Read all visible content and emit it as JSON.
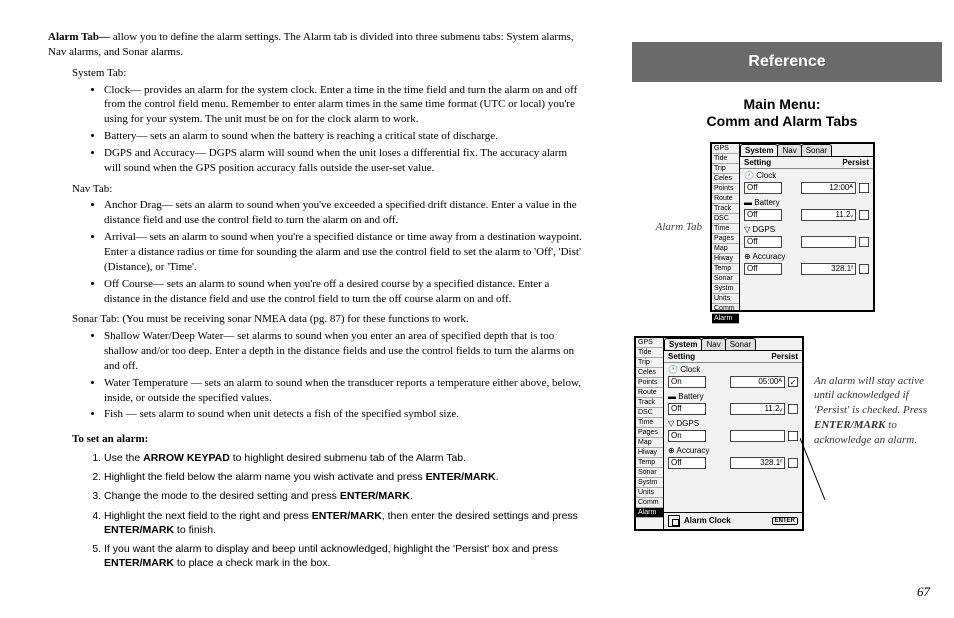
{
  "leftColumn": {
    "intro_bold": "Alarm Tab— ",
    "intro_rest": "allow you to define the alarm settings. The Alarm tab is divided into three submenu tabs: System alarms, Nav alarms, and Sonar alarms.",
    "systemTab_head": "System Tab:",
    "systemTab_items": {
      "0": "Clock— provides an alarm for the system clock. Enter a time in the time field and turn the alarm on and off from the control field menu. Remember to enter alarm times in the same time format (UTC or local) you're using for your system. The unit must be on for the clock alarm to work.",
      "1": "Battery— sets an alarm to sound when the battery is reaching a critical state of discharge.",
      "2": "DGPS and Accuracy— DGPS alarm will sound when the unit loses a differential fix. The accuracy alarm will sound when the GPS position accuracy falls outside the user-set value."
    },
    "navTab_head": "Nav Tab:",
    "navTab_items": {
      "0": "Anchor Drag— sets an alarm to sound when you've exceeded a specified drift distance. Enter a value in the distance field and use the control field to turn the alarm on and off.",
      "1": "Arrival— sets an alarm to sound when you're a specified distance or time away from a destination waypoint. Enter a distance radius or time for sounding the alarm and use the control field to set the alarm to 'Off', 'Dist' (Distance), or 'Time'.",
      "2": "Off Course— sets an alarm to sound when you're off a desired course by a specified distance. Enter a distance in the distance field and use the control field to turn the off course alarm on and off."
    },
    "sonarTab_head": "Sonar Tab: (You must be receiving sonar NMEA data (pg. 87) for these functions to work.",
    "sonarTab_items": {
      "0": "Shallow Water/Deep Water— set alarms to sound when you enter an area of specified depth that is too shallow and/or too deep. Enter a depth in the distance fields and use the control fields to turn the alarms on and off.",
      "1": "Water Temperature — sets an alarm to sound when the transducer reports a temperature either above, below, inside, or outside the specified values.",
      "2": "Fish — sets alarm to sound when unit detects a fish of the specified symbol size."
    },
    "setalarm_head": "To set an alarm:",
    "steps": {
      "0_a": "Use the ",
      "0_b": "ARROW KEYPAD",
      "0_c": " to highlight desired submenu tab of the Alarm Tab.",
      "1_a": "Highlight the field below the alarm name you wish activate and press ",
      "1_b": "ENTER/MARK",
      "1_c": ".",
      "2_a": "Change the mode to the desired setting and press ",
      "2_b": "ENTER/MARK",
      "2_c": ".",
      "3_a": "Highlight the next field to the right and press ",
      "3_b": "ENTER/MARK",
      "3_c": ", then enter the desired settings and press ",
      "3_d": "ENTER/MARK",
      "3_e": " to finish.",
      "4_a": "If you want the alarm to display and beep until acknowledged, highlight the 'Persist' box and press ",
      "4_b": "ENTER/MARK",
      "4_c": " to place a check mark in the box."
    }
  },
  "rightColumn": {
    "reference": "Reference",
    "mainmenu_l1": "Main Menu:",
    "mainmenu_l2": "Comm and Alarm Tabs",
    "caption1": "Alarm Tab",
    "caption2_a": "An alarm will stay active until acknowledged if 'Persist' is checked. Press ",
    "caption2_b": "ENTER/MARK",
    "caption2_c": " to acknowledge an alarm.",
    "pagenum": "67"
  },
  "device": {
    "sideTabs": {
      "0": "GPS",
      "1": "Tide",
      "2": "Trip",
      "3": "Celes",
      "4": "Points",
      "5": "Route",
      "6": "Track",
      "7": "DSC",
      "8": "Time",
      "9": "Pages",
      "10": "Map",
      "11": "Hiway",
      "12": "Temp",
      "13": "Sonar",
      "14": "Systm",
      "15": "Units",
      "16": "Comm",
      "17": "Alarm"
    },
    "topTabs": {
      "0": "System",
      "1": "Nav",
      "2": "Sonar"
    },
    "hdr_setting": "Setting",
    "hdr_persist": "Persist",
    "sec_clock": "Clock",
    "sec_battery": "Battery",
    "sec_dgps": "DGPS",
    "sec_accuracy": "Accuracy",
    "status": "Alarm Clock",
    "btn": "ENTER"
  },
  "dev1_rows": {
    "clock_val": "Off",
    "clock_num": "12:00ᴬ",
    "batt_val": "Off",
    "batt_num": "11.2ᵥ",
    "dgps_val": "Off",
    "acc_val": "Off",
    "acc_num": "328.1ᶠ"
  },
  "dev2_rows": {
    "clock_val": "On",
    "clock_num": "05:00ᴬ",
    "clock_chk": "✓",
    "batt_val": "Off",
    "batt_num": "11.2ᵥ",
    "dgps_val": "On",
    "acc_val": "Off",
    "acc_num": "328.1ᶠ"
  }
}
